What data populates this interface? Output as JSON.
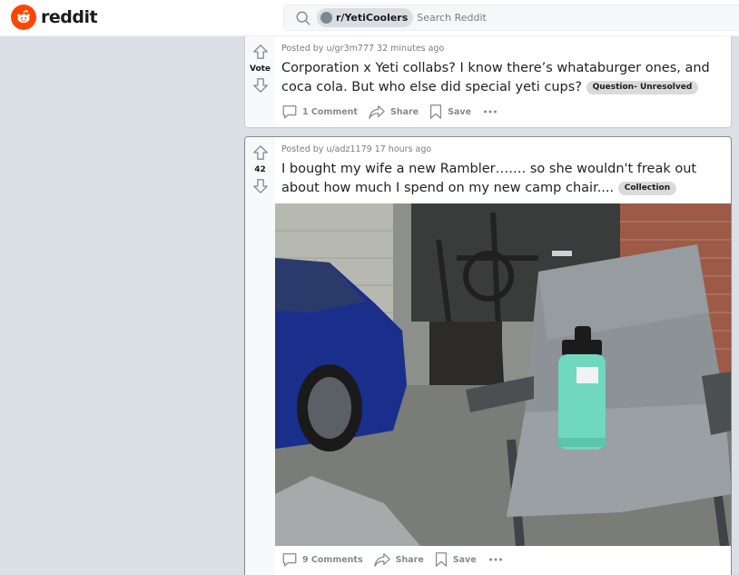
{
  "header": {
    "logo_text": "reddit",
    "subreddit_chip": "r/YetiCoolers",
    "search_placeholder": "Search Reddit"
  },
  "posts": [
    {
      "vote_label": "Vote",
      "posted_by": "Posted by u/gr3m777 32 minutes ago",
      "title": "Corporation x Yeti collabs? I know there’s whataburger ones, and coca cola. But who else did special yeti cups?",
      "flair": "Question- Unresolved",
      "comments_label": "1 Comment",
      "share_label": "Share",
      "save_label": "Save"
    },
    {
      "vote_label": "42",
      "posted_by": "Posted by u/adz1179 17 hours ago",
      "title": "I bought my wife a new Rambler……. so she wouldn't freak out about how much I spend on my new camp chair....",
      "flair": "Collection",
      "image_alt": "Teal Yeti Rambler bottle sitting on a grey mesh camp chair in a garage next to a blue car",
      "comments_label": "9 Comments",
      "share_label": "Share",
      "save_label": "Save"
    }
  ],
  "colors": {
    "brand": "#ff4500",
    "page_bg": "#dae0e6",
    "flair_bg": "#dadada"
  }
}
